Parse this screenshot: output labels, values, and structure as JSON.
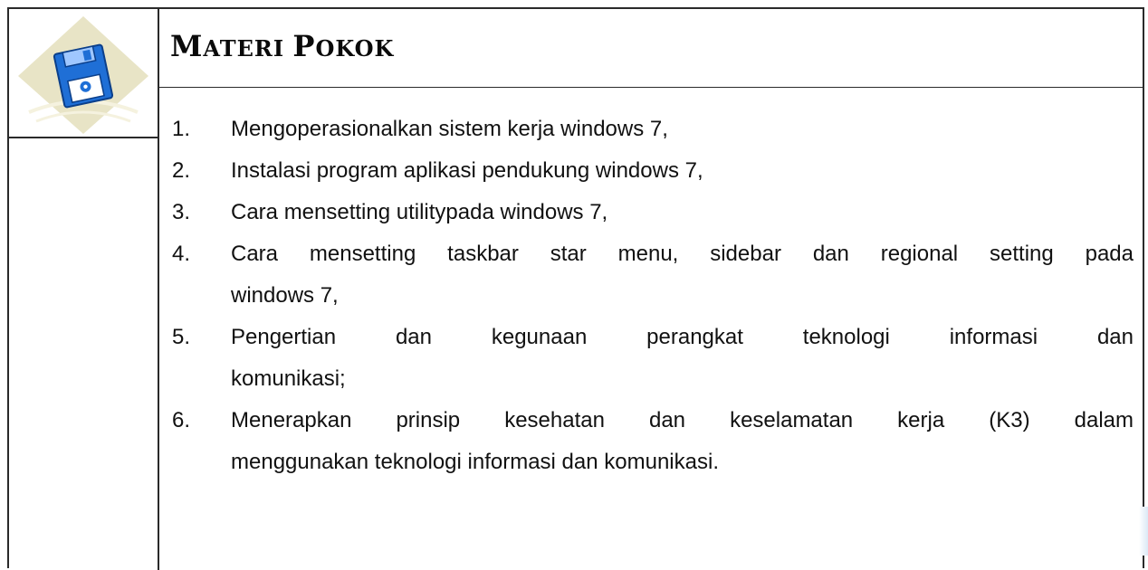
{
  "header": {
    "title_parts": [
      {
        "t": "M",
        "cap": true
      },
      {
        "t": "ATERI ",
        "cap": false
      },
      {
        "t": "P",
        "cap": true
      },
      {
        "t": "OKOK",
        "cap": false
      }
    ]
  },
  "icon": {
    "name": "floppy-disk-icon"
  },
  "items": [
    {
      "num": "1.",
      "text": "Mengoperasionalkan sistem kerja windows 7,"
    },
    {
      "num": "2.",
      "text": "Instalasi program aplikasi pendukung windows 7,"
    },
    {
      "num": "3.",
      "text": "Cara mensetting utilitypada windows 7,"
    },
    {
      "num": "4.",
      "text_full": "Cara mensetting taskbar star menu, sidebar dan regional setting pada",
      "text": "windows 7,"
    },
    {
      "num": "5.",
      "text_full": "Pengertian dan kegunaan perangkat teknologi informasi dan",
      "text": "komunikasi;"
    },
    {
      "num": "6.",
      "text_full": "Menerapkan prinsip kesehatan dan keselamatan kerja (K3) dalam",
      "text": "menggunakan teknologi informasi dan komunikasi."
    }
  ]
}
